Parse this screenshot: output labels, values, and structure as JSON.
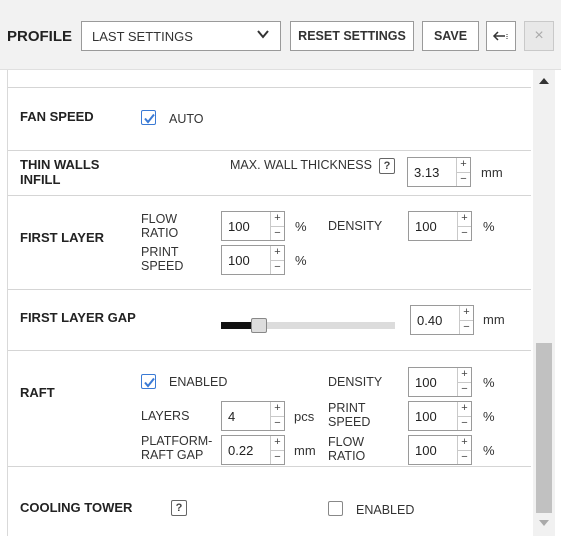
{
  "header": {
    "profile_label": "PROFILE",
    "profile_select_value": "LAST SETTINGS",
    "reset_label": "RESET SETTINGS",
    "save_label": "SAVE",
    "back_icon": "arrow-left-icon",
    "close_label": "×"
  },
  "fan_speed": {
    "title": "FAN SPEED",
    "auto_label": "AUTO",
    "auto_checked": true
  },
  "thin_walls": {
    "title_line1": "THIN WALLS",
    "title_line2": "INFILL",
    "max_wall_label": "MAX. WALL THICKNESS",
    "help": "?",
    "value": "3.13",
    "unit": "mm"
  },
  "first_layer": {
    "title": "FIRST LAYER",
    "flow_ratio_line1": "FLOW",
    "flow_ratio_line2": "RATIO",
    "flow_ratio_value": "100",
    "flow_ratio_unit": "%",
    "print_speed_line1": "PRINT",
    "print_speed_line2": "SPEED",
    "print_speed_value": "100",
    "print_speed_unit": "%",
    "density_label": "DENSITY",
    "density_value": "100",
    "density_unit": "%"
  },
  "first_layer_gap": {
    "title": "FIRST LAYER GAP",
    "slider_fraction": 0.22,
    "value": "0.40",
    "unit": "mm"
  },
  "raft": {
    "title": "RAFT",
    "enabled_label": "ENABLED",
    "enabled_checked": true,
    "layers_label": "LAYERS",
    "layers_value": "4",
    "layers_unit": "pcs",
    "platform_gap_line1": "PLATFORM-",
    "platform_gap_line2": "RAFT GAP",
    "platform_gap_value": "0.22",
    "platform_gap_unit": "mm",
    "density_label": "DENSITY",
    "density_value": "100",
    "density_unit": "%",
    "print_speed_line1": "PRINT",
    "print_speed_line2": "SPEED",
    "print_speed_value": "100",
    "print_speed_unit": "%",
    "flow_ratio_line1": "FLOW",
    "flow_ratio_line2": "RATIO",
    "flow_ratio_value": "100",
    "flow_ratio_unit": "%"
  },
  "cooling_tower": {
    "title": "COOLING TOWER",
    "help": "?",
    "enabled_label": "ENABLED",
    "enabled_checked": false
  },
  "spin_arrows": {
    "up": "+",
    "down": "−"
  },
  "colors": {
    "checkbox_accent": "#3a7ad5",
    "slider_fill": "#111111"
  }
}
